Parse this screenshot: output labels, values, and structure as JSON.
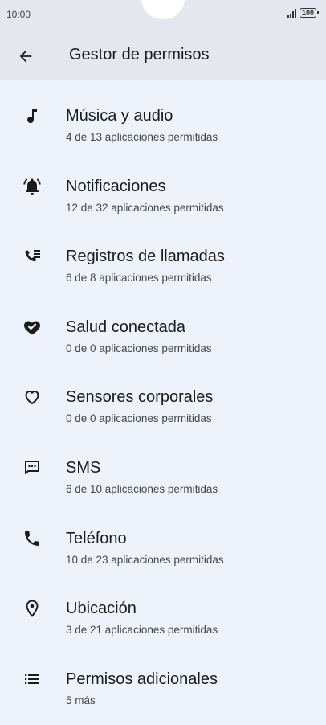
{
  "status_bar": {
    "time": "10:00",
    "battery": "100"
  },
  "header": {
    "title": "Gestor de permisos",
    "back_icon": "arrow-back-icon"
  },
  "items": [
    {
      "title": "Música y audio",
      "subtitle": "4 de 13 aplicaciones permitidas",
      "icon": "music-note-icon"
    },
    {
      "title": "Notificaciones",
      "subtitle": "12 de 32 aplicaciones permitidas",
      "icon": "notifications-icon"
    },
    {
      "title": "Registros de llamadas",
      "subtitle": "6 de 8 aplicaciones permitidas",
      "icon": "call-log-icon"
    },
    {
      "title": "Salud conectada",
      "subtitle": "0 de 0 aplicaciones permitidas",
      "icon": "health-connect-icon"
    },
    {
      "title": "Sensores corporales",
      "subtitle": "0 de 0 aplicaciones permitidas",
      "icon": "heart-outline-icon"
    },
    {
      "title": "SMS",
      "subtitle": "6 de 10 aplicaciones permitidas",
      "icon": "sms-icon"
    },
    {
      "title": "Teléfono",
      "subtitle": "10 de 23 aplicaciones permitidas",
      "icon": "phone-icon"
    },
    {
      "title": "Ubicación",
      "subtitle": "3 de 21 aplicaciones permitidas",
      "icon": "location-icon"
    },
    {
      "title": "Permisos adicionales",
      "subtitle": "5 más",
      "icon": "list-icon"
    }
  ],
  "colors": {
    "background": "#eef2fb",
    "app_bar": "#e4e7ee",
    "icon": "#1b1c20"
  }
}
